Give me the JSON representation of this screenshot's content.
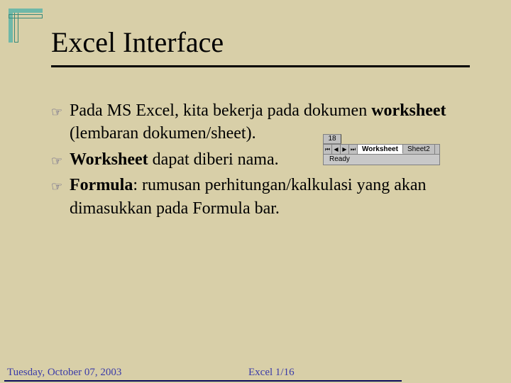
{
  "slide": {
    "title": "Excel Interface"
  },
  "bullets": {
    "item1_a": "Pada MS Excel, kita bekerja pada dokumen ",
    "item1_b_bold": "worksheet",
    "item1_c": " (lembaran dokumen/sheet).",
    "item2_a_bold": "Worksheet",
    "item2_b": " dapat diberi nama.",
    "item3_a_bold": "Formula",
    "item3_b": ": rumusan perhitungan/kalkulasi yang akan dimasukkan pada Formula bar."
  },
  "excel_widget": {
    "row_number": "18",
    "nav_first": "⏮",
    "nav_prev": "◀",
    "nav_next": "▶",
    "nav_last": "⏭",
    "active_tab": "Worksheet",
    "inactive_tab": "Sheet2",
    "status": "Ready"
  },
  "footer": {
    "left": "Tuesday, October 07, 2003",
    "center": "Excel 1/16"
  },
  "icons": {
    "bullet": "☞"
  }
}
